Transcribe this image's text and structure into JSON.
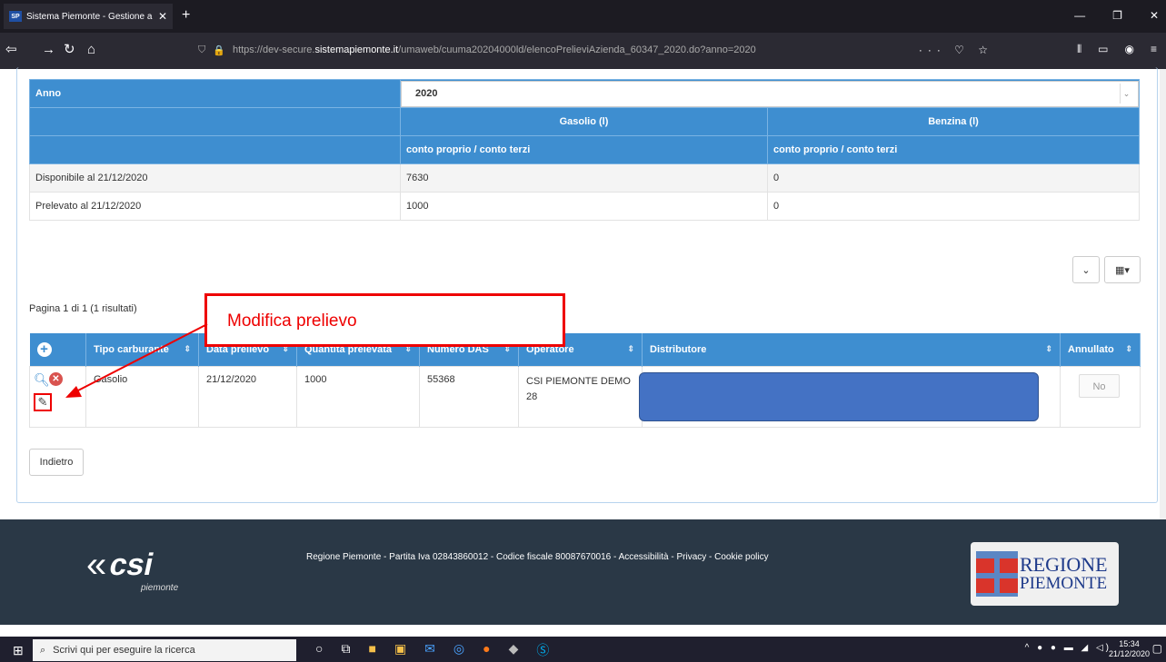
{
  "browser": {
    "tab_title": "Sistema Piemonte - Gestione a",
    "favicon": "SP",
    "url_prefix": "https://dev-secure.",
    "url_domain": "sistemapiemonte.it",
    "url_path": "/umaweb/cuuma20204000ld/elencoPrelieviAzienda_60347_2020.do?anno=2020"
  },
  "summary": {
    "anno_label": "Anno",
    "anno_value": "2020",
    "col_gasolio": "Gasolio (l)",
    "col_benzina": "Benzina (l)",
    "sub_gasolio": "conto proprio / conto terzi",
    "sub_benzina": "conto proprio / conto terzi",
    "rows": [
      {
        "label": "Disponibile al 21/12/2020",
        "gasolio": "7630",
        "benzina": "0"
      },
      {
        "label": "Prelevato al 21/12/2020",
        "gasolio": "1000",
        "benzina": "0"
      }
    ]
  },
  "pager": "Pagina 1 di 1 (1 risultati)",
  "grid": {
    "headers": [
      "Tipo carburante",
      "Data prelievo",
      "Quantità prelevata",
      "Numero DAS",
      "Operatore",
      "Distributore",
      "Annullato"
    ],
    "row": {
      "tipo": "Gasolio",
      "data": "21/12/2020",
      "quantita": "1000",
      "das": "55368",
      "operatore": "CSI PIEMONTE DEMO 28",
      "annullato": "No"
    }
  },
  "callout": "Modifica prelievo",
  "back_label": "Indietro",
  "footer": {
    "text": "Regione Piemonte - Partita Iva 02843860012 - Codice fiscale 80087670016 - Accessibilità - Privacy - Cookie policy",
    "csi": "csi",
    "csi_sub": "piemonte",
    "regione_1": "REGIONE",
    "regione_2": "PIEMONTE"
  },
  "taskbar": {
    "search_placeholder": "Scrivi qui per eseguire la ricerca",
    "time": "15:34",
    "date": "21/12/2020"
  },
  "colors": {
    "header_blue": "#3e8ed0",
    "footer": "#2a3846",
    "annotation_red": "#e00000"
  }
}
